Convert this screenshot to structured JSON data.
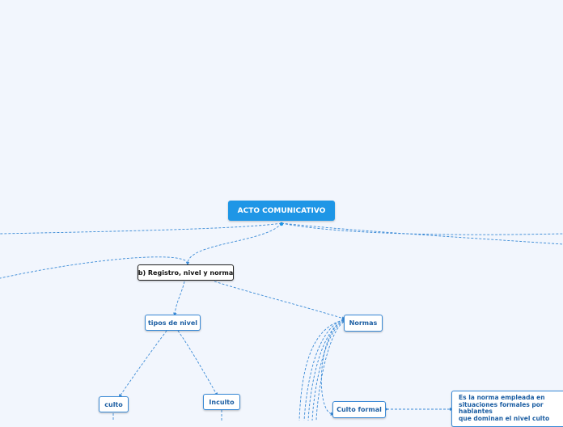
{
  "mindmap": {
    "root": "ACTO COMUNICATIVO",
    "registro": "b) Registro, nivel y norma",
    "tipos_nivel": "tipos de nivel",
    "normas": "Normas",
    "culto": "culto",
    "inculto": "Inculto",
    "culto_formal": "Culto formal",
    "culto_formal_note": [
      "Es la norma empleada en",
      "situaciones formales por",
      "hablantes",
      "que dominan el nivel culto"
    ]
  },
  "colors": {
    "background": "#f2f6fd",
    "root_fill": "#1e96e6",
    "connector": "#3a8ad6",
    "node_text": "#1d5fa3"
  }
}
